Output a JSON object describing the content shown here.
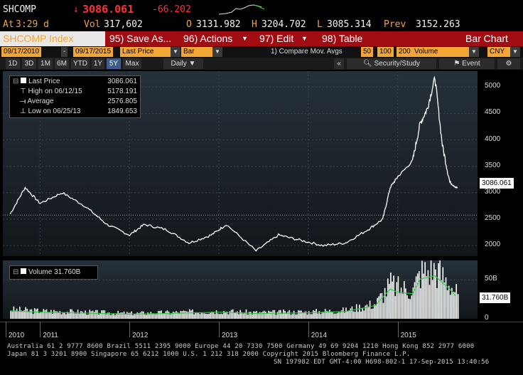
{
  "quote": {
    "ticker": "SHCOMP",
    "arrow": "↓",
    "last": "3086.061",
    "change": "-66.202",
    "at_label": "At",
    "time": "3:29 d",
    "vol_label": "Vol",
    "vol": "317,602",
    "open_label": "O",
    "open": "3131.982",
    "high_label": "H",
    "high": "3204.702",
    "low_label": "L",
    "low": "3085.314",
    "prev_label": "Prev",
    "prev": "3152.263"
  },
  "toolbar": {
    "security": "SHCOMP Index",
    "save": "95) Save As...",
    "actions": "96) Actions",
    "edit": "97) Edit",
    "table": "98) Table",
    "chart_type": "Bar Chart"
  },
  "settings": {
    "start_date": "09/17/2010",
    "dash": "-",
    "end_date": "09/17/2015",
    "field": "Last Price",
    "style": "Bar",
    "compare": "1) Compare Mov. Avgs",
    "ma1": "50",
    "ma2": "100",
    "ma3": "200",
    "lower_field": "Volume",
    "currency": "CNY"
  },
  "periods": {
    "items": [
      "1D",
      "3D",
      "1M",
      "6M",
      "YTD",
      "1Y",
      "5Y",
      "Max"
    ],
    "selected": "5Y",
    "frequency": "Daily",
    "security_study": "Security/Study",
    "event": "Event"
  },
  "legend_price": {
    "last_label": "Last Price",
    "last_value": "3086.061",
    "high_label": "High on 06/12/15",
    "high_value": "5178.191",
    "avg_label": "Average",
    "avg_value": "2576.805",
    "low_label": "Low on 06/25/13",
    "low_value": "1849.653"
  },
  "legend_volume": {
    "label": "Volume",
    "value": "31.760B"
  },
  "footer": {
    "line1": "Australia 61 2 9777 8600 Brazil 5511 2395 9000 Europe 44 20 7330 7500 Germany 49 69 9204 1210 Hong Kong 852 2977 6000",
    "line2": "Japan 81 3 3201 8900        Singapore 65 6212 1000        U.S. 1 212 318 2000        Copyright 2015 Bloomberg Finance L.P.",
    "line3": "SN 197982 EDT  GMT-4:00 H698-802-1 17-Sep-2015 13:40:56"
  },
  "colors": {
    "accent": "#f3a535",
    "toolbar": "#a10b12",
    "price_line": "#ffffff",
    "volume": "#ffffff",
    "ma_line": "#2ecc40",
    "down": "#ff2f2f"
  },
  "chart_data": [
    {
      "type": "line",
      "title": "SHCOMP Index",
      "series": [
        {
          "name": "Last Price",
          "x": [
            "2010-09",
            "2010-11",
            "2011-01",
            "2011-04",
            "2011-07",
            "2011-10",
            "2012-01",
            "2012-03",
            "2012-06",
            "2012-09",
            "2012-12",
            "2013-02",
            "2013-06",
            "2013-09",
            "2013-12",
            "2014-03",
            "2014-06",
            "2014-09",
            "2014-11",
            "2014-12",
            "2015-01",
            "2015-03",
            "2015-04",
            "2015-05",
            "2015-06",
            "2015-07",
            "2015-08",
            "2015-09"
          ],
          "values": [
            2600,
            3100,
            2800,
            3000,
            2750,
            2400,
            2200,
            2400,
            2300,
            2050,
            2200,
            2400,
            1900,
            2200,
            2100,
            2000,
            2050,
            2300,
            2500,
            3100,
            3300,
            3600,
            4300,
            4600,
            5178,
            3900,
            3200,
            3086
          ]
        }
      ],
      "ylim": [
        1800,
        5300
      ],
      "y_ticks": [
        2000,
        2500,
        3000,
        3500,
        4000,
        4500,
        5000
      ],
      "x_ticks": [
        "2010",
        "2011",
        "2012",
        "2013",
        "2014",
        "2015"
      ],
      "last_tag": "3086.061"
    },
    {
      "type": "bar",
      "title": "Volume",
      "unit": "B",
      "categories": [
        "2010-09",
        "2011-01",
        "2011-06",
        "2012-01",
        "2012-06",
        "2013-01",
        "2013-06",
        "2014-01",
        "2014-06",
        "2014-10",
        "2014-12",
        "2015-01",
        "2015-03",
        "2015-04",
        "2015-06",
        "2015-07",
        "2015-08",
        "2015-09"
      ],
      "values": [
        12,
        10,
        9,
        7,
        8,
        10,
        8,
        9,
        11,
        20,
        45,
        40,
        38,
        60,
        65,
        55,
        45,
        31.76
      ],
      "y_ticks": [
        "50B",
        "0"
      ],
      "last_tag": "31.760B"
    }
  ]
}
